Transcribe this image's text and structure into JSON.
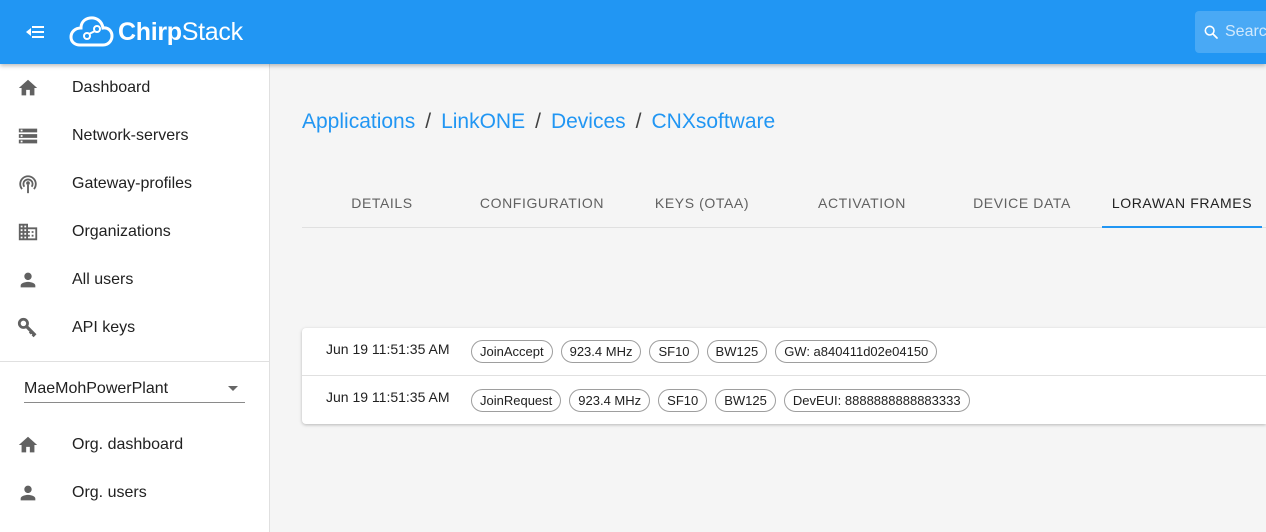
{
  "appbar": {
    "logo_prefix": "Chirp",
    "logo_suffix": "Stack",
    "search_placeholder": "Search"
  },
  "sidebar": {
    "items": [
      {
        "label": "Dashboard",
        "icon": "home-icon"
      },
      {
        "label": "Network-servers",
        "icon": "storage-icon"
      },
      {
        "label": "Gateway-profiles",
        "icon": "antenna-icon"
      },
      {
        "label": "Organizations",
        "icon": "domain-icon"
      },
      {
        "label": "All users",
        "icon": "person-icon"
      },
      {
        "label": "API keys",
        "icon": "key-icon"
      }
    ],
    "organization": "MaeMohPowerPlant",
    "org_items": [
      {
        "label": "Org. dashboard",
        "icon": "home-icon"
      },
      {
        "label": "Org. users",
        "icon": "person-icon"
      }
    ]
  },
  "breadcrumb": [
    "Applications",
    "LinkONE",
    "Devices",
    "CNXsoftware"
  ],
  "tabs": [
    "DETAILS",
    "CONFIGURATION",
    "KEYS (OTAA)",
    "ACTIVATION",
    "DEVICE DATA",
    "LORAWAN FRAMES"
  ],
  "active_tab": "LORAWAN FRAMES",
  "frames": [
    {
      "time": "Jun 19 11:51:35 AM",
      "type": "JoinAccept",
      "frequency": "923.4 MHz",
      "sf": "SF10",
      "bw": "BW125",
      "extra": "GW: a840411d02e04150"
    },
    {
      "time": "Jun 19 11:51:35 AM",
      "type": "JoinRequest",
      "frequency": "923.4 MHz",
      "sf": "SF10",
      "bw": "BW125",
      "extra": "DevEUI: 8888888888883333"
    }
  ],
  "colors": {
    "primary": "#2196f3",
    "icon": "#616161"
  }
}
